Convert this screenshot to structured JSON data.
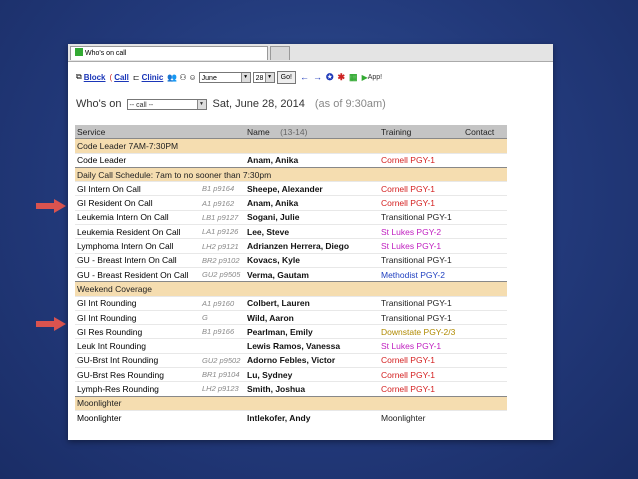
{
  "window": {
    "tab_title": "Who's on call"
  },
  "toolbar": {
    "block": "Block",
    "call": "Call",
    "clinic": "Clinic",
    "month": "June",
    "day": "28",
    "go": "Go!",
    "app": "App!"
  },
  "header": {
    "label": "Who's on",
    "select": "-- call --",
    "date": "Sat, June 28, 2014",
    "asof": "(as of 9:30am)"
  },
  "columns": {
    "service": "Service",
    "name": "Name",
    "name_count": "(13-14)",
    "training": "Training",
    "contact": "Contact"
  },
  "sections": [
    {
      "title": "Code Leader 7AM-7:30PM",
      "rows": [
        {
          "service": "Code Leader",
          "pager": "",
          "name": "Anam, Anika",
          "training": "Cornell PGY-1",
          "color": "#d42020"
        }
      ]
    },
    {
      "title": "Daily Call Schedule: 7am to no sooner than 7:30pm",
      "rows": [
        {
          "service": "GI Intern On Call",
          "pager": "B1 p9164",
          "name": "Sheepe, Alexander",
          "training": "Cornell PGY-1",
          "color": "#d42020"
        },
        {
          "service": "GI Resident On Call",
          "pager": "A1 p9162",
          "name": "Anam, Anika",
          "training": "Cornell PGY-1",
          "color": "#d42020"
        },
        {
          "service": "Leukemia Intern On Call",
          "pager": "LB1 p9127",
          "name": "Sogani, Julie",
          "training": "Transitional PGY-1",
          "color": "#222222"
        },
        {
          "service": "Leukemia Resident On Call",
          "pager": "LA1 p9126",
          "name": "Lee, Steve",
          "training": "St Lukes PGY-2",
          "color": "#c020c0"
        },
        {
          "service": "Lymphoma Intern On Call",
          "pager": "LH2 p9121",
          "name": "Adrianzen Herrera, Diego",
          "training": "St Lukes PGY-1",
          "color": "#c020c0"
        },
        {
          "service": "GU - Breast Intern On Call",
          "pager": "BR2 p9102",
          "name": "Kovacs, Kyle",
          "training": "Transitional PGY-1",
          "color": "#222222"
        },
        {
          "service": "GU - Breast Resident On Call",
          "pager": "GU2 p9505",
          "name": "Verma, Gautam",
          "training": "Methodist PGY-2",
          "color": "#2040c0"
        }
      ]
    },
    {
      "title": "Weekend Coverage",
      "rows": [
        {
          "service": "GI Int Rounding",
          "pager": "A1 p9160",
          "name": "Colbert, Lauren",
          "training": "Transitional PGY-1",
          "color": "#222222"
        },
        {
          "service": "GI Int Rounding",
          "pager": "G",
          "name": "Wild, Aaron",
          "training": "Transitional PGY-1",
          "color": "#222222"
        },
        {
          "service": "GI Res Rounding",
          "pager": "B1 p9166",
          "name": "Pearlman, Emily",
          "training": "Downstate PGY-2/3",
          "color": "#b08a00"
        },
        {
          "service": "Leuk Int Rounding",
          "pager": "",
          "name": "Lewis Ramos, Vanessa",
          "training": "St Lukes PGY-1",
          "color": "#c020c0"
        },
        {
          "service": "GU-Brst Int Rounding",
          "pager": "GU2 p9502",
          "name": "Adorno Febles, Victor",
          "training": "Cornell PGY-1",
          "color": "#d42020"
        },
        {
          "service": "GU-Brst Res Rounding",
          "pager": "BR1 p9104",
          "name": "Lu, Sydney",
          "training": "Cornell PGY-1",
          "color": "#d42020"
        },
        {
          "service": "Lymph-Res Rounding",
          "pager": "LH2 p9123",
          "name": "Smith, Joshua",
          "training": "Cornell PGY-1",
          "color": "#d42020"
        }
      ]
    },
    {
      "title": "Moonlighter",
      "rows": [
        {
          "service": "Moonlighter",
          "pager": "",
          "name": "Intlekofer, Andy",
          "training": "Moonlighter",
          "color": "#222222"
        }
      ]
    }
  ]
}
